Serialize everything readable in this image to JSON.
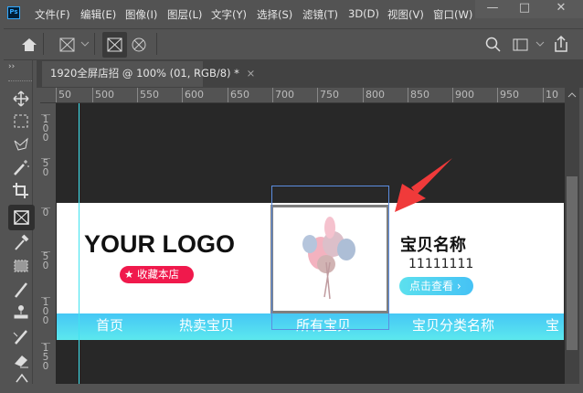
{
  "app": {
    "logo_text": "Ps"
  },
  "menu": [
    "文件(F)",
    "编辑(E)",
    "图像(I)",
    "图层(L)",
    "文字(Y)",
    "选择(S)",
    "滤镜(T)",
    "3D(D)",
    "视图(V)",
    "窗口(W)"
  ],
  "window_controls": {
    "minimize": "—",
    "maximize": "□",
    "close": "✕"
  },
  "document_tab": {
    "title": "1920全屏店招 @ 100% (01, RGB/8) *",
    "close": "×"
  },
  "ruler": {
    "horizontal": [
      "50",
      "500",
      "550",
      "600",
      "650",
      "700",
      "750",
      "800",
      "850",
      "900",
      "950",
      "10"
    ],
    "vertical": [
      "100",
      "50",
      "0",
      "50",
      "100",
      "150"
    ]
  },
  "design": {
    "logo": "YOUR LOGO",
    "favorite_button": "收藏本店",
    "product_name": "宝贝名称",
    "product_number": "11111111",
    "view_button": "点击查看 ›",
    "nav": [
      "首页",
      "热卖宝贝",
      "所有宝贝",
      "宝贝分类名称",
      "宝"
    ]
  },
  "colors": {
    "accent": "#31a8ff",
    "favorite": "#f0194c",
    "nav_top": "#45c7f5",
    "nav_bottom": "#5ce8ee",
    "arrow": "#f03a3a"
  }
}
